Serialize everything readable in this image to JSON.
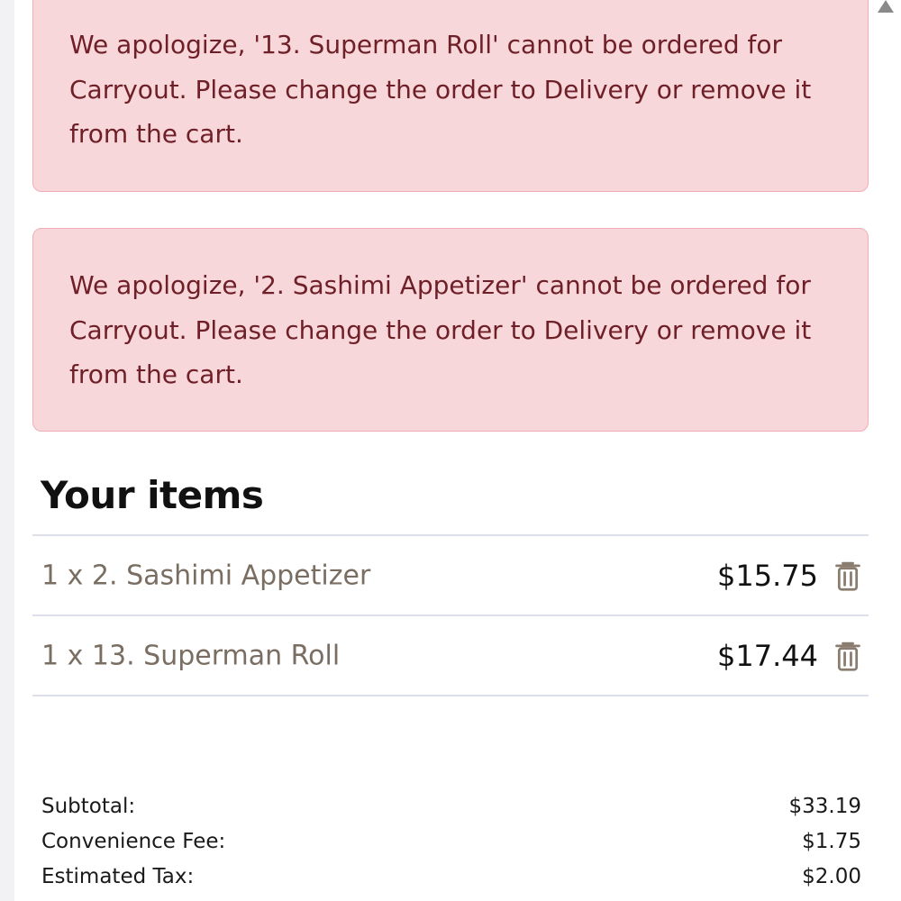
{
  "alerts": [
    {
      "message": "We apologize, '13. Superman Roll' cannot be ordered for Carryout. Please change the order to Delivery or remove it from the cart."
    },
    {
      "message": "We apologize, '2. Sashimi Appetizer' cannot be ordered for Carryout. Please change the order to Delivery or remove it from the cart."
    }
  ],
  "cart": {
    "title": "Your items",
    "items": [
      {
        "label": "1 x 2. Sashimi Appetizer",
        "price": "$15.75",
        "icon": "trash-icon"
      },
      {
        "label": "1 x 13. Superman Roll",
        "price": "$17.44",
        "icon": "trash-icon"
      }
    ]
  },
  "totals": {
    "rows": [
      {
        "label": "Subtotal:",
        "value": "$33.19"
      },
      {
        "label": "Convenience Fee:",
        "value": "$1.75"
      },
      {
        "label": "Estimated Tax:",
        "value": "$2.00"
      }
    ]
  },
  "colors": {
    "alert_bg": "#f8d7da",
    "alert_border": "#f1aeb5",
    "alert_text": "#6e1f27",
    "item_text": "#7a6e62",
    "divider": "#dde0ea"
  }
}
